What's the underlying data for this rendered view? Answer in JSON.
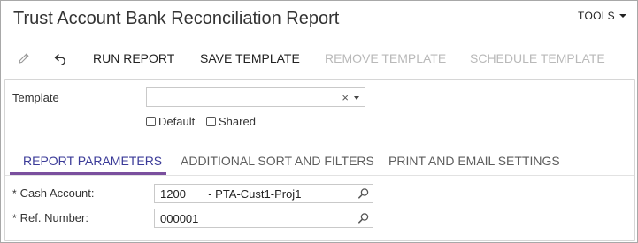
{
  "window": {
    "title": "Trust Account Bank Reconciliation Report",
    "tools_label": "TOOLS"
  },
  "toolbar": {
    "edit_icon": "pencil-icon",
    "undo_icon": "undo-icon",
    "run_report": "RUN REPORT",
    "save_template": "SAVE TEMPLATE",
    "remove_template": "REMOVE TEMPLATE",
    "schedule_template": "SCHEDULE TEMPLATE"
  },
  "template": {
    "label": "Template",
    "value": "",
    "clear_glyph": "×",
    "default_label": "Default",
    "default_checked": false,
    "shared_label": "Shared",
    "shared_checked": false
  },
  "tabs": [
    {
      "label": "REPORT PARAMETERS",
      "active": true
    },
    {
      "label": "ADDITIONAL SORT AND FILTERS",
      "active": false
    },
    {
      "label": "PRINT AND EMAIL SETTINGS",
      "active": false
    }
  ],
  "parameters": {
    "cash_account": {
      "required_mark": "*",
      "label": "Cash Account:",
      "value": "1200       - PTA-Cust1-Proj1"
    },
    "ref_number": {
      "required_mark": "*",
      "label": "Ref. Number:",
      "value": "000001"
    }
  },
  "colors": {
    "active_tab_text": "#3b3b98",
    "active_tab_underline": "#7a4f9e",
    "disabled_text": "#b9b9b9"
  }
}
